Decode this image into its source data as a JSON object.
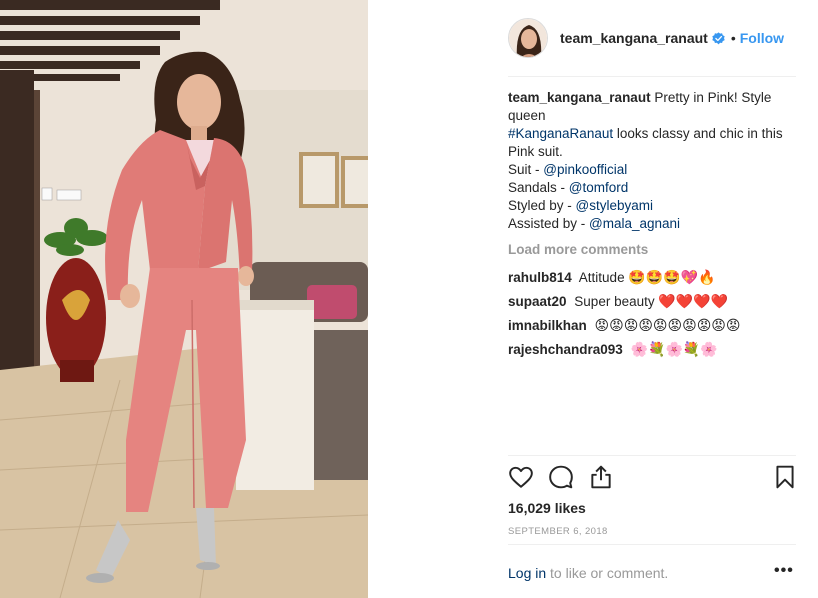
{
  "post": {
    "username": "team_kangana_ranaut",
    "follow_label": "Follow",
    "separator": "•",
    "caption": {
      "username": "team_kangana_ranaut",
      "line1": "Pretty in Pink! Style queen",
      "hashtag": "#KanganaRanaut",
      "line2": " looks classy and chic in this Pink suit.",
      "suit_label": "Suit - ",
      "suit_handle": "@pinkoofficial",
      "sandals_label": "Sandals - ",
      "sandals_handle": "@tomford",
      "styled_label": "Styled by - ",
      "styled_handle": "@stylebyami",
      "assisted_label": "Assisted by - ",
      "assisted_handle": "@mala_agnani"
    },
    "load_more": "Load more comments",
    "comments": [
      {
        "user": "rahulb814",
        "text": "Attitude",
        "emoji": "🤩🤩🤩💖🔥"
      },
      {
        "user": "supaat20",
        "text": "Super beauty",
        "emoji": "❤️❤️❤️❤️"
      },
      {
        "user": "imnabilkhan",
        "text": "",
        "emoji": "😡😡😡😡😡😡😡😡😡😡"
      },
      {
        "user": "rajeshchandra093",
        "text": "",
        "emoji": "🌸💐🌸💐🌸"
      }
    ],
    "likes": "16,029 likes",
    "date": "SEPTEMBER 6, 2018",
    "login_link": "Log in",
    "login_text": " to like or comment.",
    "more_label": "•••"
  },
  "icons": {
    "verified": "verified-badge-icon",
    "like": "heart-icon",
    "comment": "comment-icon",
    "share": "share-icon",
    "save": "bookmark-icon"
  },
  "colors": {
    "link": "#003569",
    "follow": "#3897f0",
    "muted": "#999999",
    "text": "#262626",
    "suit": "#e07b77"
  }
}
